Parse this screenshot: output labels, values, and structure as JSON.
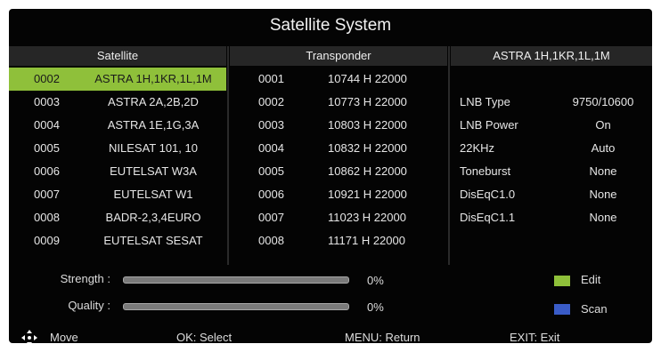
{
  "title": "Satellite System",
  "headers": {
    "satellite": "Satellite",
    "transponder": "Transponder",
    "selected_satellite": "ASTRA 1H,1KR,1L,1M"
  },
  "satellites": [
    {
      "num": "0002",
      "name": "ASTRA 1H,1KR,1L,1M",
      "selected": true
    },
    {
      "num": "0003",
      "name": "ASTRA 2A,2B,2D"
    },
    {
      "num": "0004",
      "name": "ASTRA 1E,1G,3A"
    },
    {
      "num": "0005",
      "name": "NILESAT 101, 10"
    },
    {
      "num": "0006",
      "name": "EUTELSAT W3A"
    },
    {
      "num": "0007",
      "name": "EUTELSAT W1"
    },
    {
      "num": "0008",
      "name": "BADR-2,3,4EURO"
    },
    {
      "num": "0009",
      "name": "EUTELSAT SESAT"
    }
  ],
  "transponders": [
    {
      "num": "0001",
      "freq": "10744 H 22000"
    },
    {
      "num": "0002",
      "freq": "10773 H 22000"
    },
    {
      "num": "0003",
      "freq": "10803 H 22000"
    },
    {
      "num": "0004",
      "freq": "10832 H 22000"
    },
    {
      "num": "0005",
      "freq": "10862 H 22000"
    },
    {
      "num": "0006",
      "freq": "10921 H 22000"
    },
    {
      "num": "0007",
      "freq": "11023 H 22000"
    },
    {
      "num": "0008",
      "freq": "11171 H 22000"
    }
  ],
  "settings": [
    {
      "key": "LNB Type",
      "value": "9750/10600"
    },
    {
      "key": "LNB Power",
      "value": "On"
    },
    {
      "key": "22KHz",
      "value": "Auto"
    },
    {
      "key": "Toneburst",
      "value": "None"
    },
    {
      "key": "DisEqC1.0",
      "value": "None"
    },
    {
      "key": "DisEqC1.1",
      "value": "None"
    }
  ],
  "signal": {
    "strength_label": "Strength :",
    "strength_value": "0%",
    "quality_label": "Quality :",
    "quality_value": "0%"
  },
  "legend": {
    "edit_label": "Edit",
    "edit_color": "#8fc03a",
    "scan_label": "Scan",
    "scan_color": "#3a5cc8"
  },
  "footer": {
    "move": "Move",
    "ok": "OK: Select",
    "menu": "MENU: Return",
    "exit": "EXIT: Exit"
  },
  "icons": {
    "move": "four-way-arrow-icon"
  }
}
